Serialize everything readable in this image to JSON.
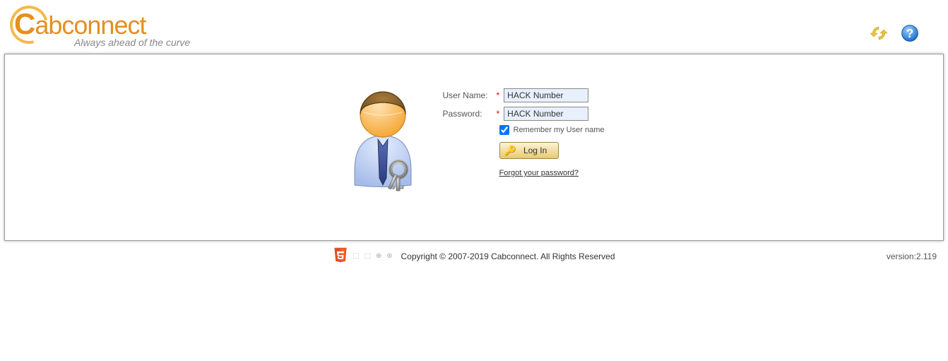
{
  "brand": {
    "name_rest": "abconnect",
    "tagline": "Always ahead of the curve"
  },
  "login": {
    "username_label": "User Name:",
    "password_label": "Password:",
    "username_value": "HACK Number",
    "password_value": "HACK Number",
    "remember_label": "Remember my User name",
    "login_button": "Log In",
    "forgot_link": "Forgot your password?"
  },
  "footer": {
    "copyright": "Copyright © 2007-2019 Cabconnect. All Rights Reserved",
    "version": "version:2.119"
  }
}
